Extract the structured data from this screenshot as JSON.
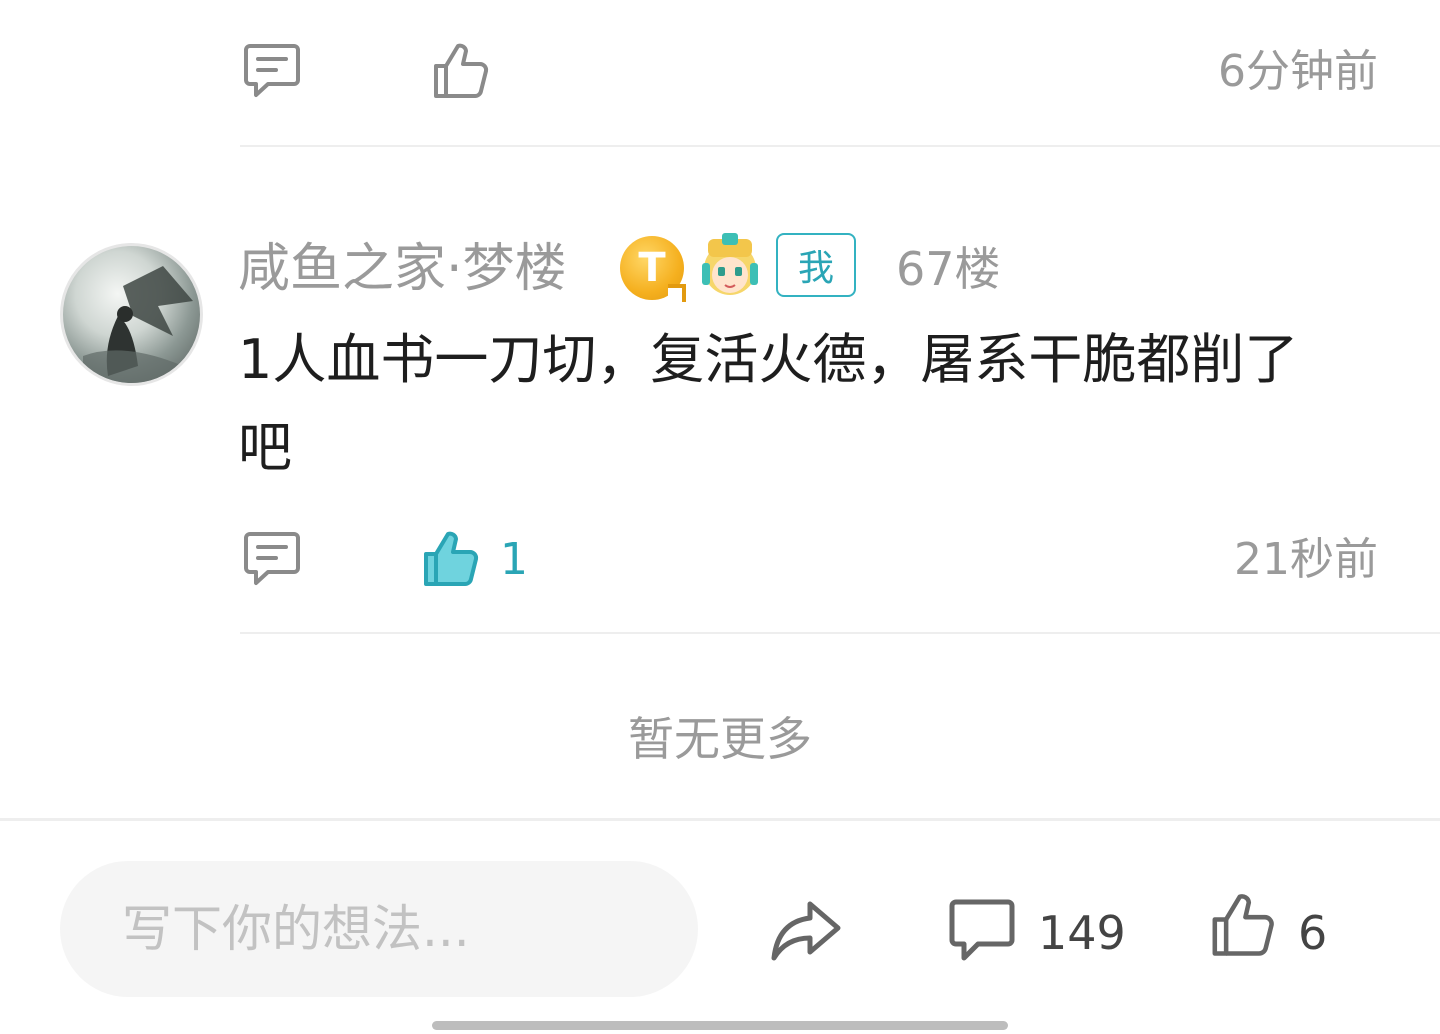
{
  "previous_comment": {
    "time": "6分钟前"
  },
  "comment": {
    "username": "咸鱼之家·梦楼",
    "badge_t_letter": "T",
    "me_tag": "我",
    "floor": "67楼",
    "text": "1人血书一刀切，复活火德，屠系干脆都削了吧",
    "like_count": "1",
    "time": "21秒前"
  },
  "no_more_text": "暂无更多",
  "bottom_bar": {
    "input_placeholder": "写下你的想法...",
    "comment_count": "149",
    "like_count": "6"
  },
  "colors": {
    "accent": "#2aa5b5",
    "muted_text": "#9a9a9a",
    "like_fill": "#6fd3de"
  },
  "icons": [
    "comment-icon",
    "thumbs-up-icon",
    "share-icon"
  ]
}
